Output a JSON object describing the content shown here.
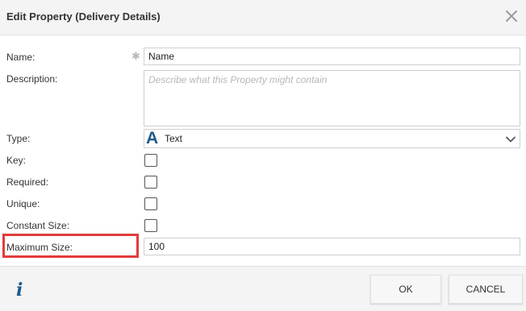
{
  "dialog": {
    "title": "Edit Property (Delivery Details)",
    "close_icon": "close-icon"
  },
  "form": {
    "name": {
      "label": "Name:",
      "value": "Name",
      "required": true
    },
    "description": {
      "label": "Description:",
      "value": "",
      "placeholder": "Describe what this Property might contain"
    },
    "type": {
      "label": "Type:",
      "icon_glyph": "A",
      "value": "Text"
    },
    "key": {
      "label": "Key:",
      "checked": false
    },
    "required": {
      "label": "Required:",
      "checked": false
    },
    "unique": {
      "label": "Unique:",
      "checked": false
    },
    "constant_size": {
      "label": "Constant Size:",
      "checked": false
    },
    "maximum_size": {
      "label": "Maximum Size:",
      "value": "100"
    }
  },
  "footer": {
    "info_glyph": "i",
    "ok_label": "OK",
    "cancel_label": "CANCEL"
  },
  "colors": {
    "accent": "#1e5a8a",
    "highlight": "#e23b3b",
    "header_bg": "#f4f4f4"
  }
}
